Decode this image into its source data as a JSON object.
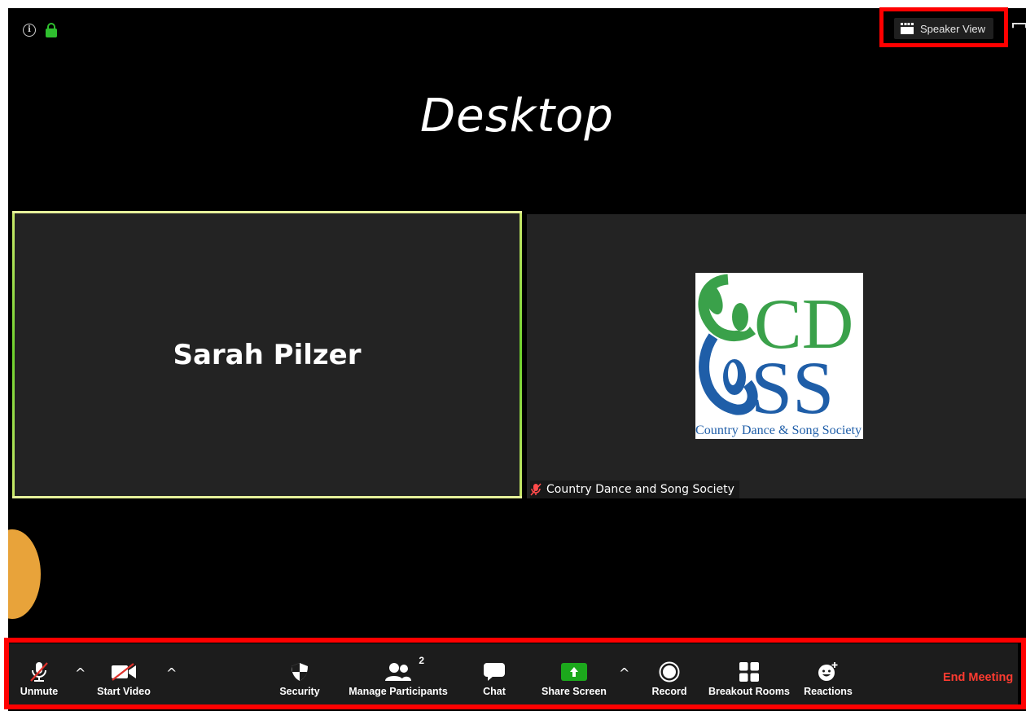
{
  "top": {
    "speaker_view_label": "Speaker View",
    "info_icon": "info-icon",
    "lock_icon": "lock-icon",
    "lock_color": "#2fbf2f"
  },
  "annotation": {
    "caption": "Desktop",
    "highlight_color": "#ff0000"
  },
  "tiles": [
    {
      "name": "Sarah Pilzer",
      "active_border": "#e6f09a"
    },
    {
      "name": "Country Dance and Song Society",
      "muted": true,
      "logo": {
        "letters_top": "CD",
        "letters_bottom": "SS",
        "caption": "Country Dance & Song Society"
      }
    }
  ],
  "toolbar": {
    "unmute": "Unmute",
    "start_video": "Start Video",
    "security": "Security",
    "manage_participants": "Manage Participants",
    "participant_count": "2",
    "chat": "Chat",
    "share_screen": "Share Screen",
    "record": "Record",
    "breakout_rooms": "Breakout Rooms",
    "reactions": "Reactions",
    "end_meeting": "End Meeting",
    "end_color": "#ff3b30",
    "share_color": "#1ca81c"
  }
}
